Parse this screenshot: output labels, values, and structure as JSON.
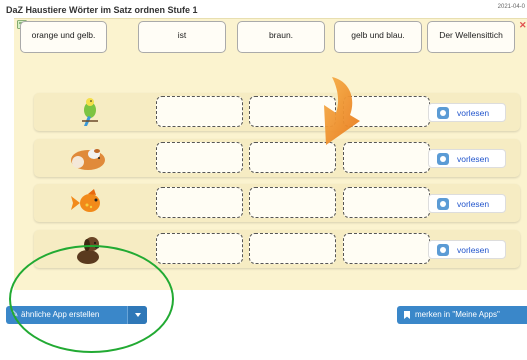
{
  "header": {
    "title": "DaZ Haustiere Wörter im Satz ordnen Stufe 1",
    "date": "2021-04-0"
  },
  "word_cards": [
    {
      "label": "orange und gelb."
    },
    {
      "label": "ist"
    },
    {
      "label": "braun."
    },
    {
      "label": "gelb und blau."
    },
    {
      "label": "Der Wellensittich"
    }
  ],
  "rows": [
    {
      "animal": "budgie",
      "read_label": "vorlesen"
    },
    {
      "animal": "guinea-pig",
      "read_label": "vorlesen"
    },
    {
      "animal": "goldfish",
      "read_label": "vorlesen"
    },
    {
      "animal": "dog",
      "read_label": "vorlesen"
    }
  ],
  "footer": {
    "similar_app_label": "ähnliche App erstellen",
    "bookmark_label": "merken in \"Meine Apps\""
  },
  "colors": {
    "app_background": "#fbf3cf",
    "row_background": "#f6ecc3",
    "button_blue": "#3a87c9",
    "annotation_green": "#22aa33",
    "arrow_orange": "#f08a1c"
  },
  "icons": {
    "top_left": "app-icon",
    "top_right": "close-icon",
    "speaker": "speaker-icon",
    "edit": "edit-icon",
    "dropdown": "caret-down-icon",
    "bookmark": "bookmark-icon"
  }
}
